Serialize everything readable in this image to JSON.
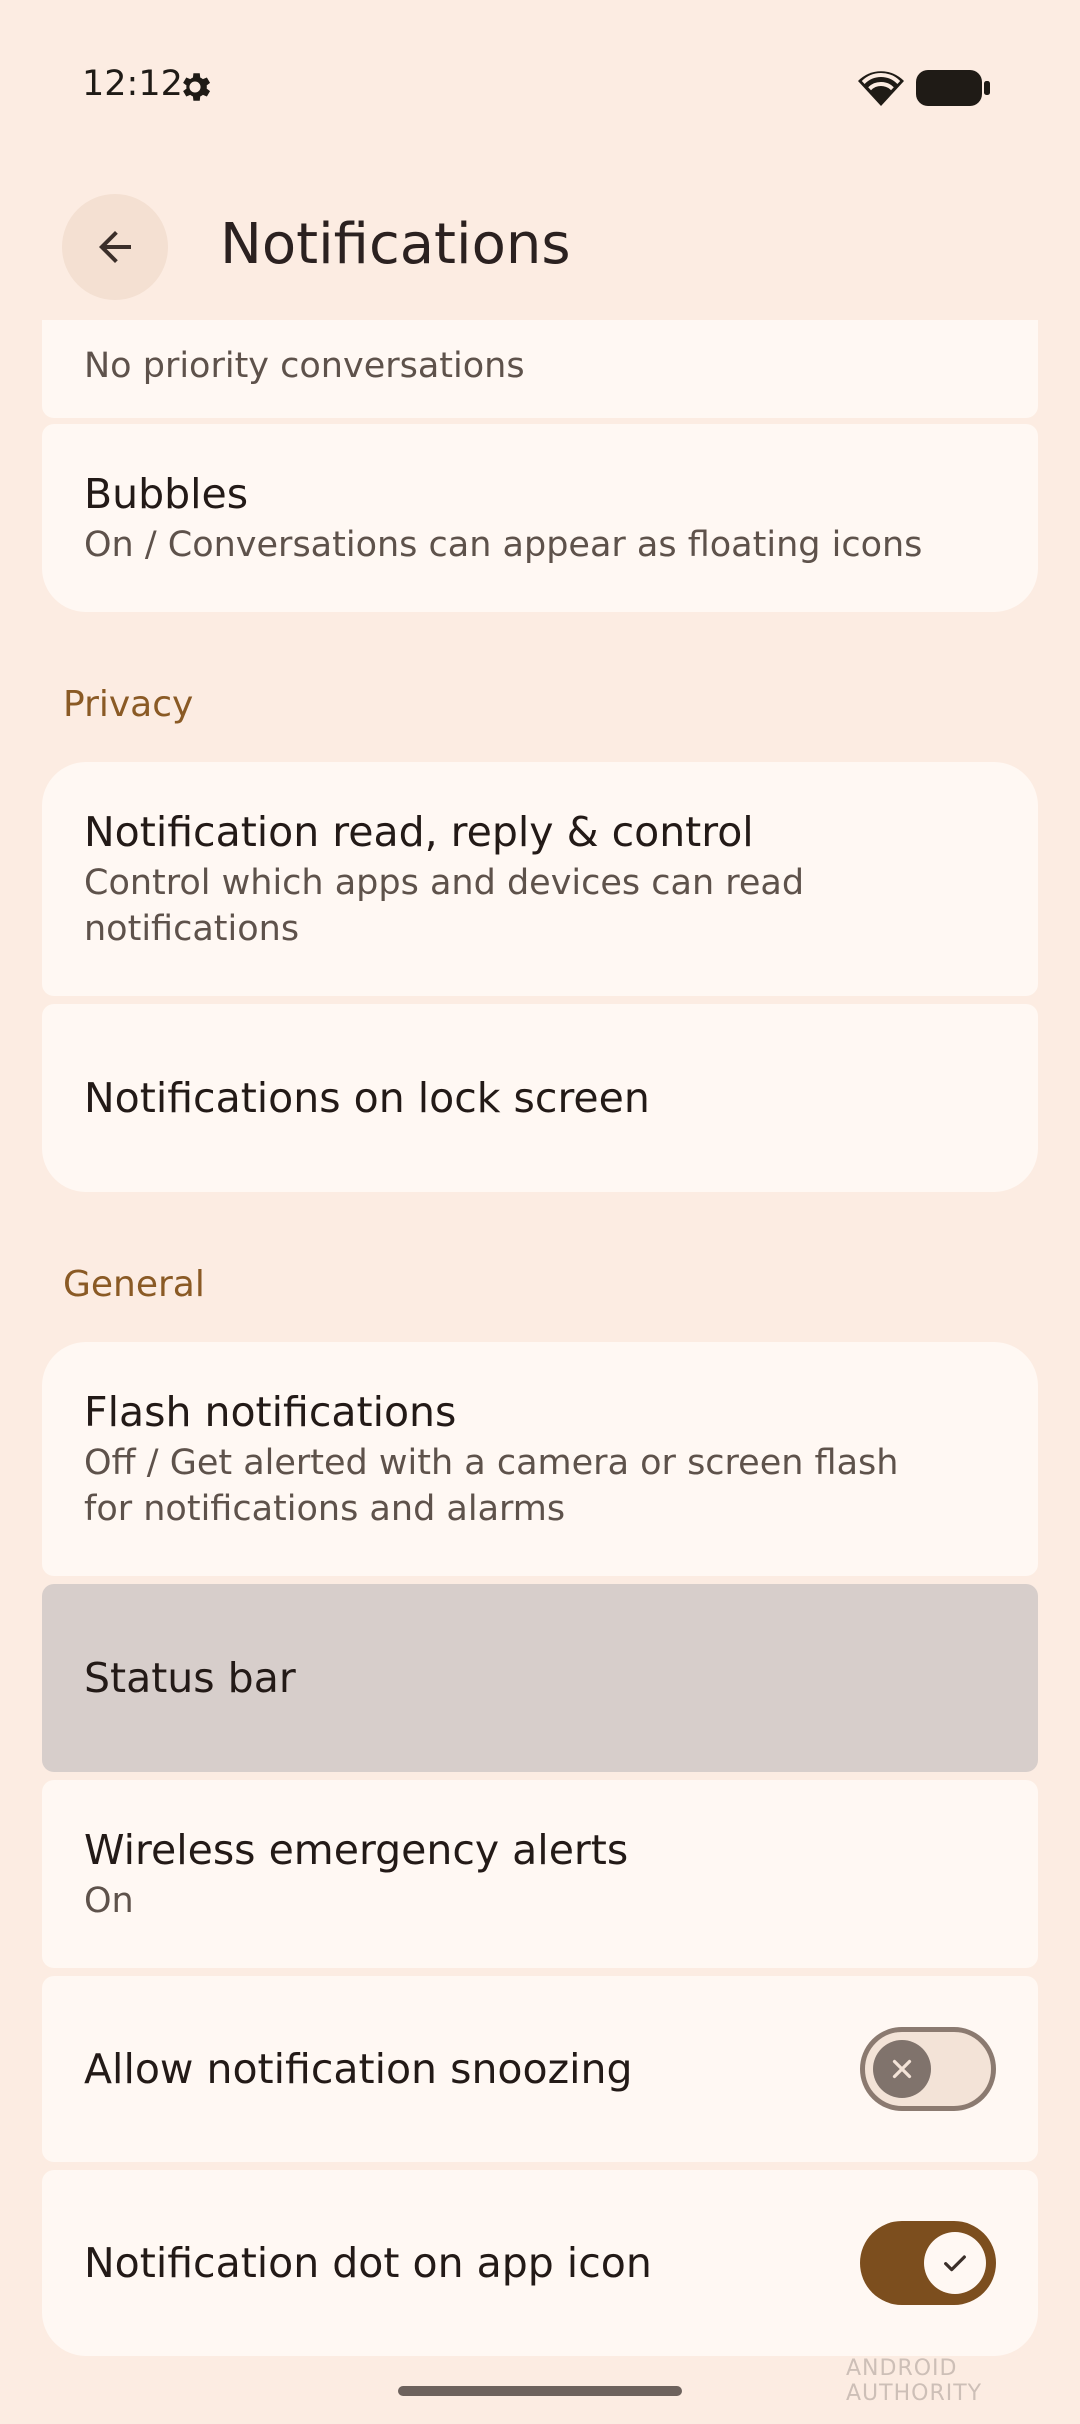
{
  "status_bar": {
    "time": "12:12"
  },
  "app_bar": {
    "title": "Notifications"
  },
  "cards_top": [
    {
      "subtitle": "No priority conversations"
    },
    {
      "title": "Bubbles",
      "subtitle": "On / Conversations can appear as floating icons"
    }
  ],
  "privacy": {
    "header": "Privacy",
    "items": [
      {
        "title": "Notification read, reply & control",
        "subtitle": "Control which apps and devices can read notifications"
      },
      {
        "title": "Notifications on lock screen"
      }
    ]
  },
  "general": {
    "header": "General",
    "items": [
      {
        "title": "Flash notifications",
        "subtitle": "Off / Get alerted with a camera or screen flash for notifications and alarms"
      },
      {
        "title": "Status bar"
      },
      {
        "title": "Wireless emergency alerts",
        "subtitle": "On"
      },
      {
        "title": "Allow notification snoozing",
        "toggle": "off"
      },
      {
        "title": "Notification dot on app icon",
        "toggle": "on"
      }
    ]
  },
  "watermark": "ANDROID AUTHORITY",
  "colors": {
    "background": "#fcece2",
    "card": "#fff8f3",
    "accent": "#7c4e1e",
    "section_header": "#8a5a25"
  }
}
